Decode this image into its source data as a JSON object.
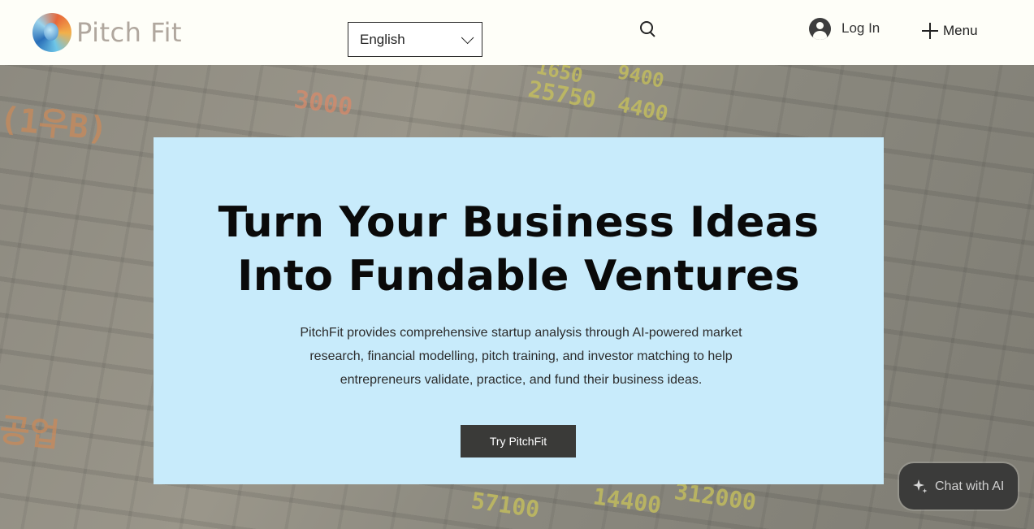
{
  "header": {
    "logo_text": "Pitch Fit",
    "language": {
      "selected": "English"
    },
    "login_label": "Log In",
    "menu_label": "Menu"
  },
  "hero": {
    "headline_line1": "Turn Your Business Ideas",
    "headline_line2": "Into Fundable Ventures",
    "subcopy": "PitchFit provides comprehensive startup analysis through AI-powered market research, financial modelling, pitch training, and investor matching to help entrepreneurs validate, practice, and fund their business ideas.",
    "cta_label": "Try PitchFit",
    "board_figures": [
      "3000",
      "25750",
      "4400",
      "(1우B)",
      "14400",
      "57100",
      "312000",
      "공업",
      "9400",
      "1650"
    ]
  },
  "chat": {
    "label": "Chat with AI",
    "icon": "sparkle-icon"
  },
  "colors": {
    "card_bg": "#c8ebfb",
    "cta_bg": "#3a3a38",
    "chat_bg": "#3b3b3a",
    "header_bg": "#fefef8"
  }
}
